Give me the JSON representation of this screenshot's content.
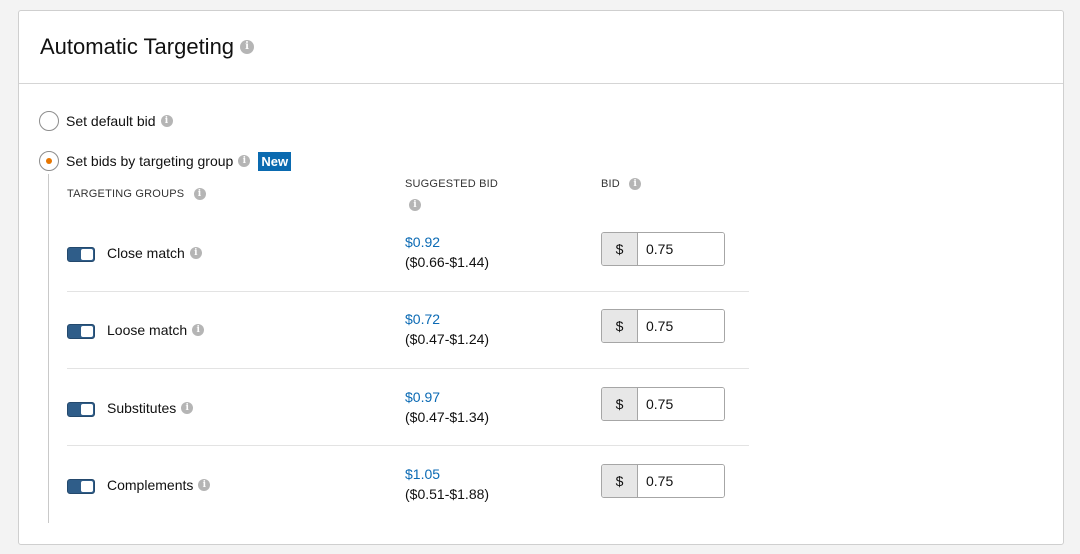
{
  "section": {
    "title": "Automatic Targeting"
  },
  "options": {
    "default_bid_label": "Set default bid",
    "by_group_label": "Set bids by targeting group",
    "new_badge": "New"
  },
  "columns": {
    "groups": "TARGETING GROUPS",
    "suggested": "SUGGESTED BID",
    "bid": "BID"
  },
  "rows": [
    {
      "label": "Close match",
      "suggested": "$0.92",
      "range": "($0.66-$1.44)",
      "currency": "$",
      "bid": "0.75",
      "enabled": true
    },
    {
      "label": "Loose match",
      "suggested": "$0.72",
      "range": "($0.47-$1.24)",
      "currency": "$",
      "bid": "0.75",
      "enabled": true
    },
    {
      "label": "Substitutes",
      "suggested": "$0.97",
      "range": "($0.47-$1.34)",
      "currency": "$",
      "bid": "0.75",
      "enabled": true
    },
    {
      "label": "Complements",
      "suggested": "$1.05",
      "range": "($0.51-$1.88)",
      "currency": "$",
      "bid": "0.75",
      "enabled": true
    }
  ],
  "icons": {
    "info": "info-icon",
    "info_glyph": "i"
  },
  "colors": {
    "link": "#0b6ab4",
    "radio_selected": "#e77600",
    "badge": "#0a6ab0",
    "toggle_on": "#2f5d89"
  }
}
